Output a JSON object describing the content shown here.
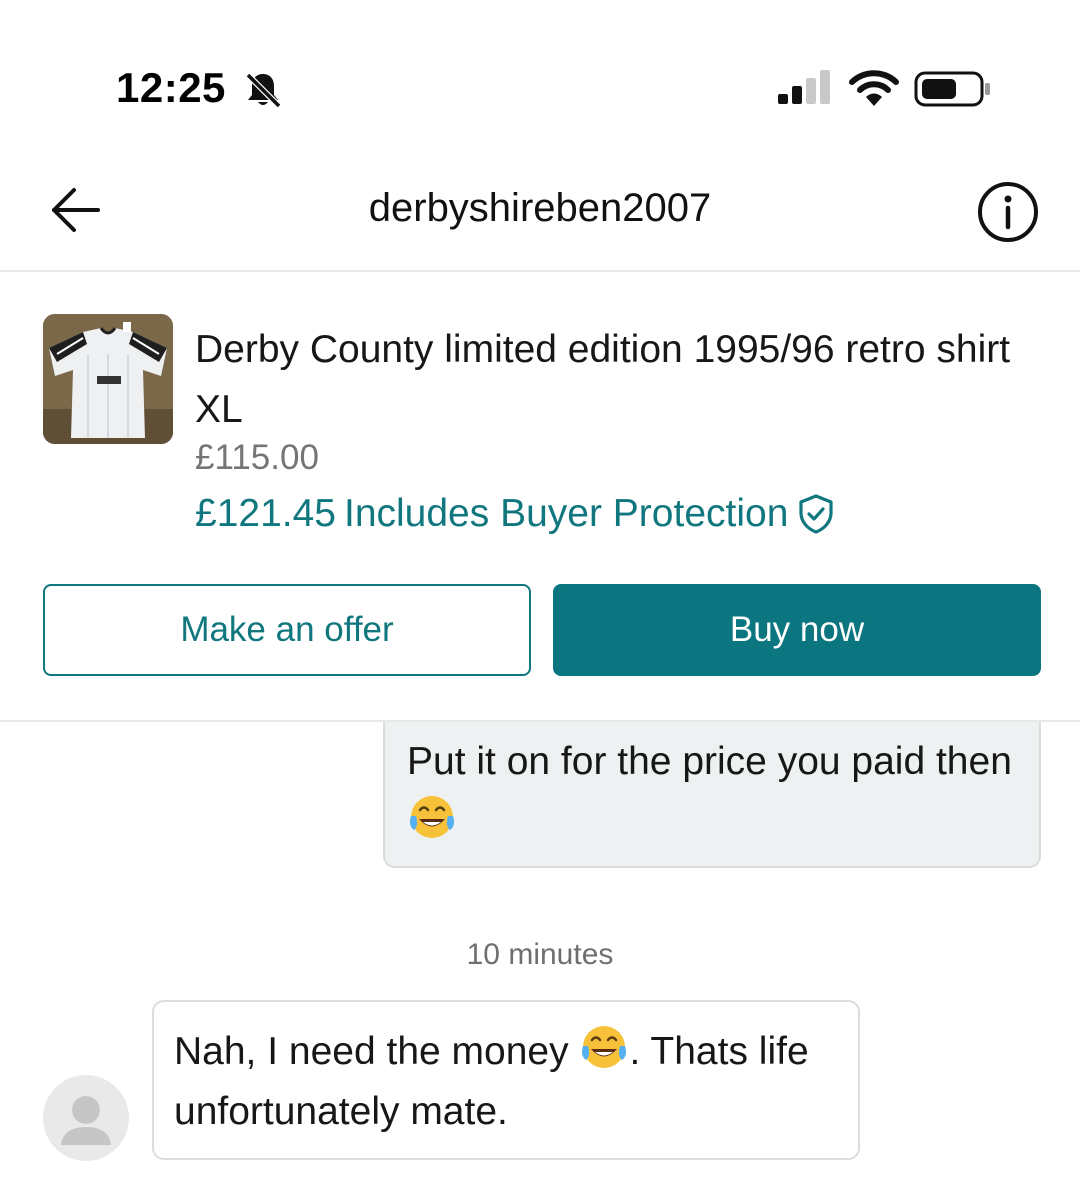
{
  "status_bar": {
    "time": "12:25",
    "icons": [
      "bell-muted-icon",
      "signal-icon",
      "wifi-icon",
      "battery-icon"
    ]
  },
  "header": {
    "title": "derbyshireben2007",
    "left_icon": "back-arrow-icon",
    "right_icon": "info-icon"
  },
  "item": {
    "title": "Derby County limited edition 1995/96 retro shirt XL",
    "price": "£115.00",
    "total_price": "£121.45",
    "protection_label": "Includes Buyer Protection",
    "protection_icon": "shield-check-icon",
    "offer_button": "Make an offer",
    "buy_button": "Buy now"
  },
  "messages": {
    "own": {
      "text_before_emoji": "Put it on for the price you paid then ",
      "emoji": "tears-of-joy-emoji"
    },
    "timestamp": "10 minutes",
    "other": {
      "text_before_emoji": "Nah, I need the money ",
      "emoji": "tears-of-joy-emoji",
      "text_after_emoji": ". Thats life unfortunately mate."
    }
  },
  "colors": {
    "accent": "#11777f",
    "buy_button_bg": "#0b7680",
    "own_bubble_bg": "#eef1f1"
  }
}
